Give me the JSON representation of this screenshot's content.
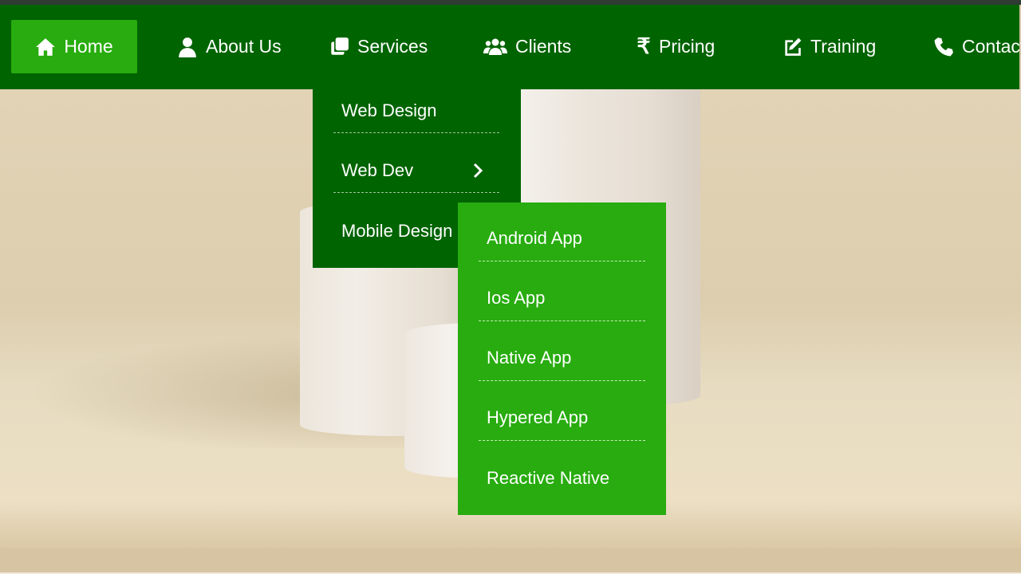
{
  "nav": {
    "items": [
      {
        "label": "Home",
        "icon": "home-icon",
        "active": true
      },
      {
        "label": "About Us",
        "icon": "user-icon"
      },
      {
        "label": "Services",
        "icon": "copy-icon"
      },
      {
        "label": "Clients",
        "icon": "users-icon"
      },
      {
        "label": "Pricing",
        "icon": "rupee-icon",
        "glyph": "₹"
      },
      {
        "label": "Training",
        "icon": "edit-icon"
      },
      {
        "label": "Contact",
        "icon": "phone-icon"
      }
    ]
  },
  "services_menu": {
    "items": [
      {
        "label": "Web Design"
      },
      {
        "label": "Web Dev",
        "has_submenu": true
      },
      {
        "label": "Mobile Design"
      }
    ]
  },
  "mobile_submenu": {
    "items": [
      {
        "label": "Android App"
      },
      {
        "label": "Ios App"
      },
      {
        "label": "Native App"
      },
      {
        "label": "Hypered App"
      },
      {
        "label": "Reactive Native"
      }
    ]
  },
  "colors": {
    "navbar_bg": "#006400",
    "active_bg": "#28ac0f",
    "submenu_bg": "#28ac0f",
    "text": "#ffffff"
  }
}
